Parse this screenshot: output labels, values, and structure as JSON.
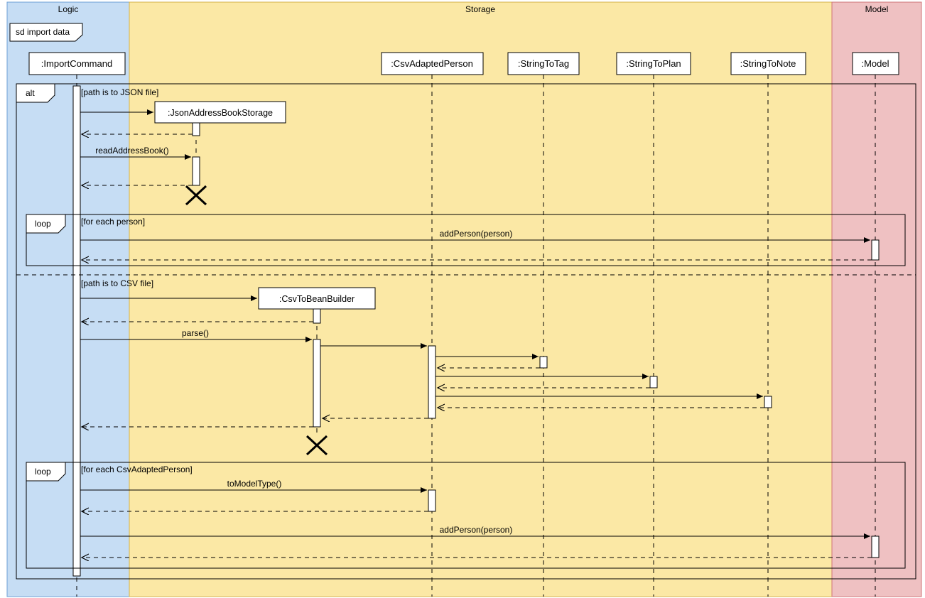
{
  "diagram_title": "sd import data",
  "regions": {
    "logic": {
      "label": "Logic",
      "fill": "#c6ddf4",
      "stroke": "#6ea0d6"
    },
    "storage": {
      "label": "Storage",
      "fill": "#fbe8a5",
      "stroke": "#d4b24b"
    },
    "model": {
      "label": "Model",
      "fill": "#efc1c2",
      "stroke": "#cf7578"
    }
  },
  "lifelines": {
    "importCommand": {
      "label": ":ImportCommand"
    },
    "csvAdaptedPerson": {
      "label": ":CsvAdaptedPerson"
    },
    "stringToTag": {
      "label": ":StringToTag"
    },
    "stringToPlan": {
      "label": ":StringToPlan"
    },
    "stringToNote": {
      "label": ":StringToNote"
    },
    "model": {
      "label": ":Model"
    },
    "jsonStorage": {
      "label": ":JsonAddressBookStorage"
    },
    "csvBuilder": {
      "label": ":CsvToBeanBuilder"
    }
  },
  "fragments": {
    "alt": {
      "label": "alt"
    },
    "loop1": {
      "label": "loop"
    },
    "loop2": {
      "label": "loop"
    }
  },
  "guards": {
    "json": "[path is to JSON file]",
    "csv": "[path is to CSV file]",
    "eachPerson": "[for each person]",
    "eachCsv": "[for each CsvAdaptedPerson]"
  },
  "messages": {
    "readAddressBook": "readAddressBook()",
    "addPerson": "addPerson(person)",
    "parse": "parse()",
    "toModelType": "toModelType()"
  }
}
